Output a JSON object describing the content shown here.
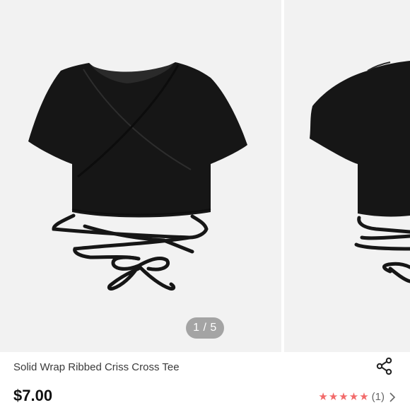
{
  "gallery": {
    "counter": "1 / 5",
    "current_index": 1,
    "total_images": 5
  },
  "product": {
    "title": "Solid Wrap Ribbed Criss Cross Tee",
    "price": "$7.00"
  },
  "rating": {
    "stars": 5,
    "max_stars": 5,
    "count_label": "(1)",
    "star_color": "#f26a6a"
  },
  "icons": {
    "share": "share-icon",
    "star": "star-icon",
    "chevron": "chevron-right-icon"
  },
  "colors": {
    "garment": "#161616",
    "image_background": "#f2f2f2"
  }
}
